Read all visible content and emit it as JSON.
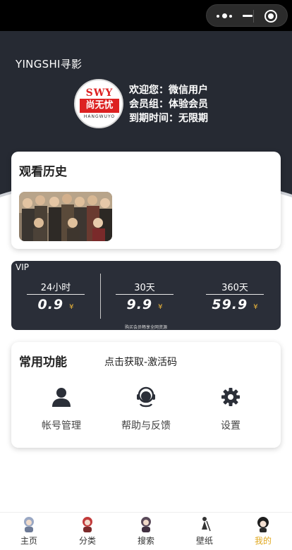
{
  "header": {
    "app_title": "YINGSHI寻影",
    "avatar_logo": {
      "top": "SWY",
      "middle": "尚无忧",
      "bottom": "HANGWUYO"
    },
    "welcome": "欢迎您：微信用户",
    "member_group": "会员组：体验会员",
    "expire": "到期时间：无限期"
  },
  "history": {
    "title": "观看历史"
  },
  "vip": {
    "label": "VIP",
    "plans": [
      {
        "duration": "24小时",
        "price": "0.9",
        "currency": "¥"
      },
      {
        "duration": "30天",
        "price": "9.9",
        "currency": "¥"
      },
      {
        "duration": "360天",
        "price": "59.9",
        "currency": "¥"
      }
    ],
    "footnote": "购买会员畅享全网资源"
  },
  "functions": {
    "title": "常用功能",
    "activation_link": "点击获取-激活码",
    "items": [
      {
        "label": "帐号管理",
        "icon": "user-icon"
      },
      {
        "label": "帮助与反馈",
        "icon": "headset-icon"
      },
      {
        "label": "设置",
        "icon": "gear-icon"
      }
    ]
  },
  "tabbar": {
    "items": [
      {
        "label": "主页",
        "icon": "home-avatar-icon"
      },
      {
        "label": "分类",
        "icon": "category-avatar-icon"
      },
      {
        "label": "搜索",
        "icon": "search-avatar-icon"
      },
      {
        "label": "壁纸",
        "icon": "wallpaper-avatar-icon"
      },
      {
        "label": "我的",
        "icon": "mine-avatar-icon"
      }
    ],
    "active_index": 4,
    "active_color": "#e0a81e"
  },
  "colors": {
    "header_bg": "#262a33",
    "vip_bg": "#2a2e38",
    "price_currency": "#e9b43a"
  }
}
